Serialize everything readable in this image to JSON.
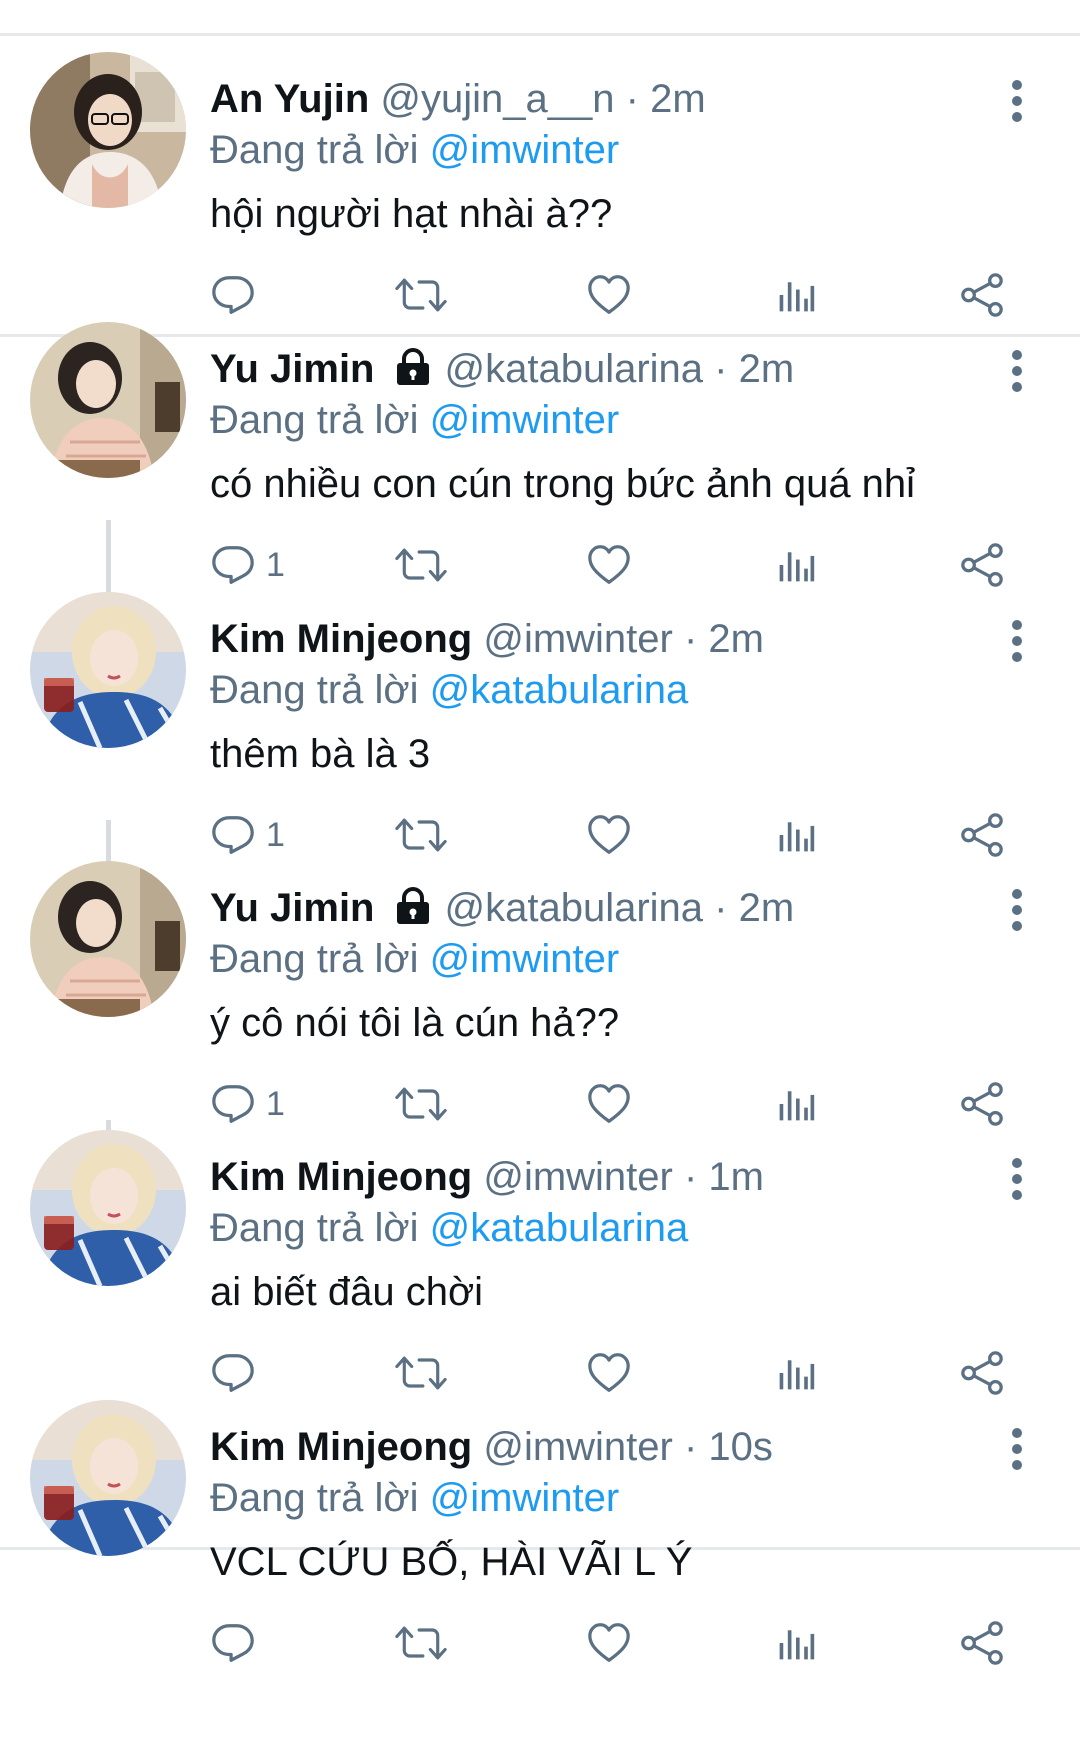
{
  "colors": {
    "link": "#1d9bf0",
    "secondary_text": "#5b7083",
    "primary_text": "#0f1419",
    "divider": "#e6e9ec",
    "thread_line": "#d7dbdf"
  },
  "icons": [
    "reply-icon",
    "retweet-icon",
    "like-icon",
    "analytics-icon",
    "share-icon",
    "more-options-icon",
    "lock-icon"
  ],
  "reply_prefix": "Đang trả lời",
  "tweets": [
    {
      "name": "An Yujin",
      "handle": "@yujin_a__n",
      "time": "· 2m",
      "protected": false,
      "reply_to": "@imwinter",
      "text": "hội người hạt nhài à??",
      "reply_count": ""
    },
    {
      "name": "Yu Jimin",
      "handle": "@katabularina",
      "time": "· 2m",
      "protected": true,
      "reply_to": "@imwinter",
      "text": "có nhiều con cún trong bức ảnh quá nhỉ",
      "reply_count": "1"
    },
    {
      "name": "Kim Minjeong",
      "handle": "@imwinter",
      "time": "· 2m",
      "protected": false,
      "reply_to": "@katabularina",
      "text": "thêm bà là 3",
      "reply_count": "1"
    },
    {
      "name": "Yu Jimin",
      "handle": "@katabularina",
      "time": "· 2m",
      "protected": true,
      "reply_to": "@imwinter",
      "text": "ý cô nói tôi là cún hả??",
      "reply_count": "1"
    },
    {
      "name": "Kim Minjeong",
      "handle": "@imwinter",
      "time": "· 1m",
      "protected": false,
      "reply_to": "@katabularina",
      "text": "ai biết đâu chời",
      "reply_count": ""
    },
    {
      "name": "Kim Minjeong",
      "handle": "@imwinter",
      "time": "· 10s",
      "protected": false,
      "reply_to": "@imwinter",
      "text": "VCL CỨU BỐ, HÀI VÃI L Ý",
      "reply_count": ""
    }
  ]
}
